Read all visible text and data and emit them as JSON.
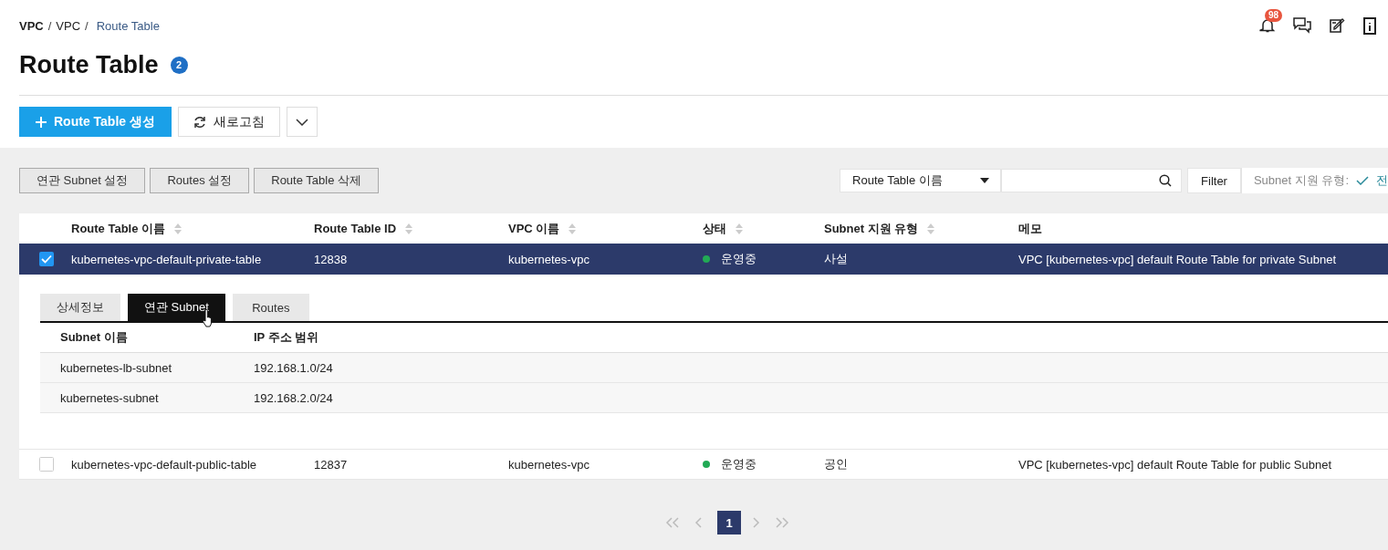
{
  "breadcrumb": {
    "separator": "/",
    "items": [
      {
        "label": "VPC",
        "current": false
      },
      {
        "label": "VPC",
        "current": false
      },
      {
        "label": "Route Table",
        "current": true
      }
    ]
  },
  "header_icons": [
    {
      "kind": "bell",
      "badge": "98"
    },
    {
      "kind": "chat"
    },
    {
      "kind": "note"
    },
    {
      "kind": "info"
    }
  ],
  "page_title": {
    "text": "Route Table",
    "count": "2"
  },
  "actions": [
    {
      "kind": "primary",
      "label": "Route Table 생성"
    },
    {
      "kind": "secondary",
      "label": "새로고침"
    },
    {
      "kind": "dropdown"
    }
  ],
  "toolbar": {
    "buttons": [
      "연관 Subnet 설정",
      "Routes 설정",
      "Route Table 삭제"
    ],
    "search_select": "Route Table 이름",
    "filter_button": "Filter",
    "filter_chip": {
      "label": "Subnet 지원 유형:",
      "value": "전"
    }
  },
  "table": {
    "columns": [
      {
        "label": "Route Table 이름",
        "sortable": true
      },
      {
        "label": "Route Table ID",
        "sortable": true
      },
      {
        "label": "VPC 이름",
        "sortable": true
      },
      {
        "label": "상태",
        "sortable": true
      },
      {
        "label": "Subnet 지원 유형",
        "sortable": true
      },
      {
        "label": "메모",
        "sortable": false
      }
    ],
    "rows": [
      {
        "checked": true,
        "selected": true,
        "expanded": true,
        "name": "kubernetes-vpc-default-private-table",
        "id": "12838",
        "vpc": "kubernetes-vpc",
        "status": "운영중",
        "color": "#22aa55",
        "subnet_type": "사설",
        "memo": "VPC [kubernetes-vpc] default Route Table for private Subnet"
      },
      {
        "checked": false,
        "selected": false,
        "expanded": false,
        "name": "kubernetes-vpc-default-public-table",
        "id": "12837",
        "vpc": "kubernetes-vpc",
        "status": "운영중",
        "color": "#22aa55",
        "subnet_type": "공인",
        "memo": "VPC [kubernetes-vpc] default Route Table for public Subnet"
      }
    ]
  },
  "detail": {
    "tabs": [
      {
        "label": "상세정보",
        "selected": false
      },
      {
        "label": "연관 Subnet",
        "selected": true
      },
      {
        "label": "Routes",
        "selected": false
      }
    ],
    "columns": [
      "Subnet 이름",
      "IP 주소 범위"
    ],
    "rows": [
      [
        "kubernetes-lb-subnet",
        "192.168.1.0/24"
      ],
      [
        "kubernetes-subnet",
        "192.168.2.0/24"
      ]
    ]
  },
  "pagination": {
    "pages": [
      {
        "label": "1",
        "selected": true
      }
    ]
  }
}
